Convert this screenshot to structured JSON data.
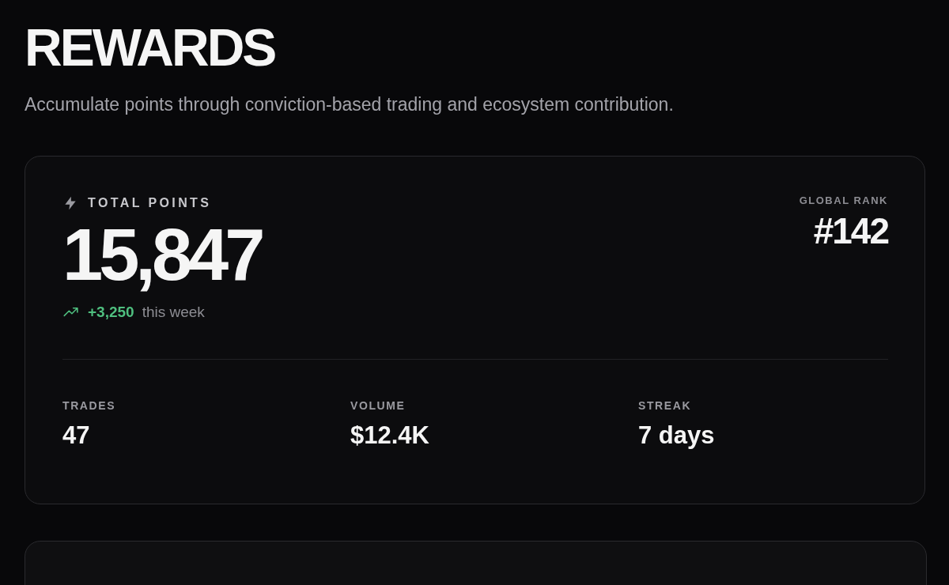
{
  "page": {
    "title": "REWARDS",
    "subtitle": "Accumulate points through conviction-based trading and ecosystem contribution."
  },
  "points_card": {
    "label": "TOTAL POINTS",
    "total": "15,847",
    "change": "+3,250",
    "change_period": "this week",
    "rank_label": "GLOBAL RANK",
    "rank": "#142",
    "stats": [
      {
        "label": "TRADES",
        "value": "47"
      },
      {
        "label": "VOLUME",
        "value": "$12.4K"
      },
      {
        "label": "STREAK",
        "value": "7 days"
      }
    ]
  }
}
